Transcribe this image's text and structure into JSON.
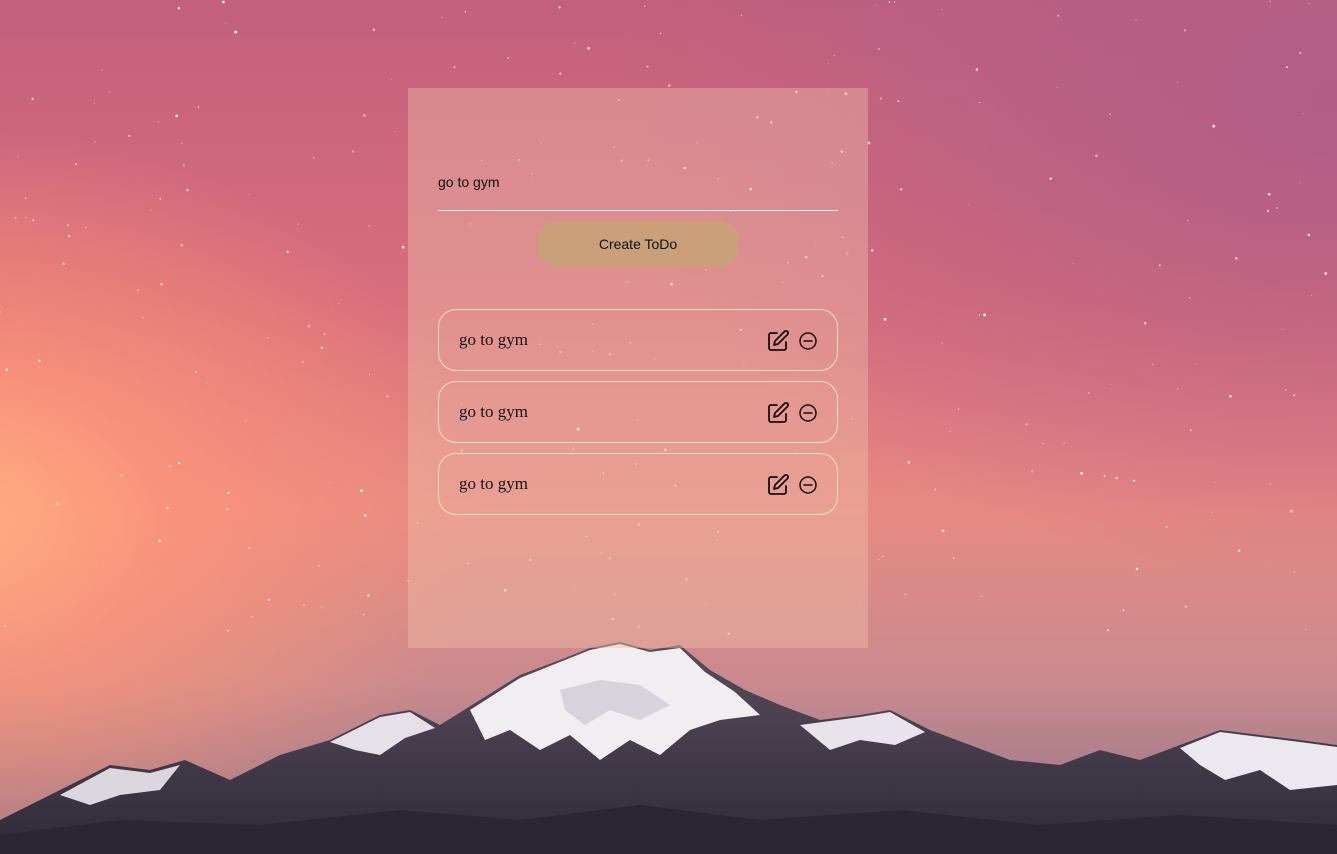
{
  "form": {
    "input_value": "go to gym",
    "create_button_label": "Create ToDo"
  },
  "todos": [
    {
      "text": "go to gym",
      "edit_icon": "edit-icon",
      "remove_icon": "remove-icon"
    },
    {
      "text": "go to gym",
      "edit_icon": "edit-icon",
      "remove_icon": "remove-icon"
    },
    {
      "text": "go to gym",
      "edit_icon": "edit-icon",
      "remove_icon": "remove-icon"
    }
  ],
  "colors": {
    "panel_tint": "#eebeaa",
    "button": "#c9a07a",
    "item_border": "#f3dfb8",
    "input_underline": "#e6f2f4"
  }
}
